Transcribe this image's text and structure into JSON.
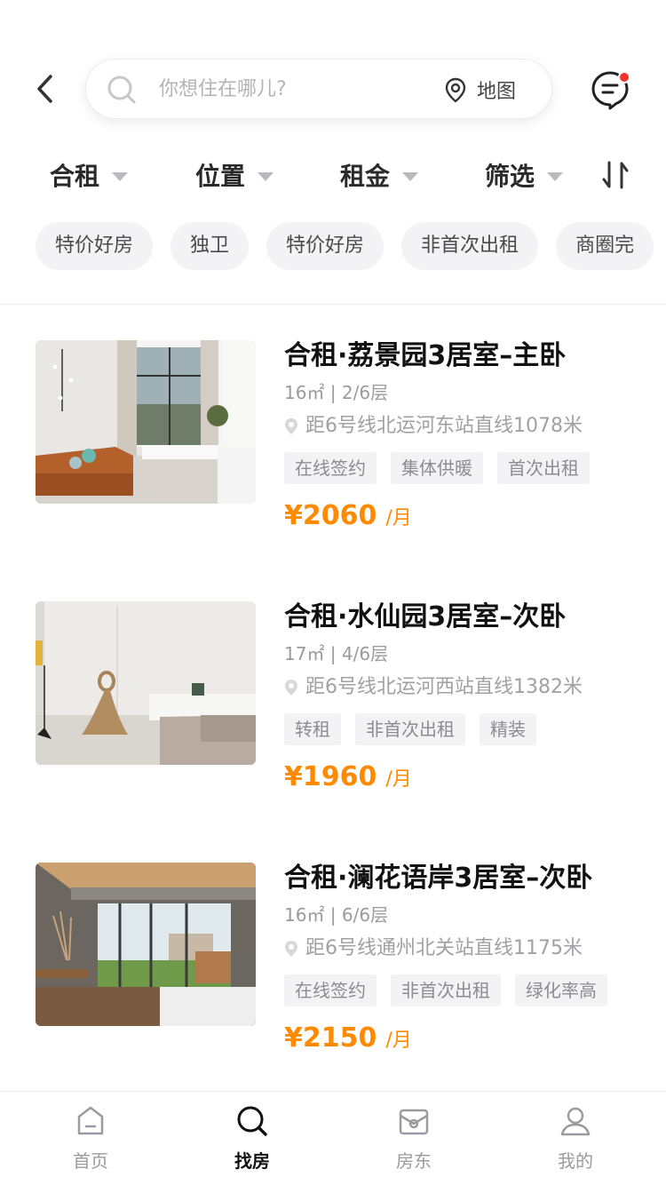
{
  "header": {
    "search_placeholder": "你想住在哪儿?",
    "map_label": "地图"
  },
  "filters": [
    {
      "label": "合租"
    },
    {
      "label": "位置"
    },
    {
      "label": "租金"
    },
    {
      "label": "筛选"
    }
  ],
  "quick_tags": [
    "特价好房",
    "独卫",
    "特价好房",
    "非首次出租",
    "商圈完"
  ],
  "listings": [
    {
      "title": "合租·荔景园3居室–主卧",
      "meta": "16㎡ | 2/6层",
      "distance": "距6号线北运河东站直线1078米",
      "tags": [
        "在线签约",
        "集体供暖",
        "首次出租"
      ],
      "price": "¥2060",
      "price_unit": "/月"
    },
    {
      "title": "合租·水仙园3居室–次卧",
      "meta": "17㎡ | 4/6层",
      "distance": "距6号线北运河西站直线1382米",
      "tags": [
        "转租",
        "非首次出租",
        "精装"
      ],
      "price": "¥1960",
      "price_unit": "/月"
    },
    {
      "title": "合租·澜花语岸3居室–次卧",
      "meta": "16㎡ | 6/6层",
      "distance": "距6号线通州北关站直线1175米",
      "tags": [
        "在线签约",
        "非首次出租",
        "绿化率高"
      ],
      "price": "¥2150",
      "price_unit": "/月"
    }
  ],
  "tabbar": {
    "items": [
      {
        "label": "首页",
        "icon": "home-icon"
      },
      {
        "label": "找房",
        "icon": "search-icon"
      },
      {
        "label": "房东",
        "icon": "landlord-icon"
      },
      {
        "label": "我的",
        "icon": "profile-icon"
      }
    ],
    "active": "找房"
  },
  "colors": {
    "price": "#ff8a00",
    "notification_dot": "#f2332b",
    "chip_bg": "#f3f3f5"
  }
}
